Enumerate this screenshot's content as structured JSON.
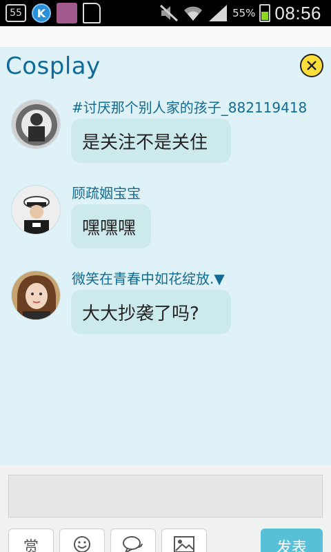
{
  "status_bar": {
    "badge_left": "55",
    "app_k": "K",
    "battery_percent": "55%",
    "battery_level": 0.55,
    "time": "08:56"
  },
  "header": {
    "title": "Cosplay"
  },
  "messages": [
    {
      "username": "#讨厌那个别人家的孩子_882119418",
      "text": "是关注不是关住"
    },
    {
      "username": "顾疏姻宝宝",
      "text": "嘿嘿嘿"
    },
    {
      "username": "微笑在青春中如花绽放.▼",
      "text": "大大抄袭了吗?"
    }
  ],
  "composer": {
    "input_value": "",
    "tools": [
      {
        "label": "赏",
        "icon": "reward-icon"
      },
      {
        "label": "",
        "icon": "emoji-icon"
      },
      {
        "label": "",
        "icon": "chat-bubble-icon"
      },
      {
        "label": "",
        "icon": "image-icon"
      }
    ],
    "send_label": "发表"
  },
  "colors": {
    "panel_bg": "#dff2f8",
    "bubble_bg": "#cce9ec",
    "accent_blue": "#0f6a9a",
    "send_bg": "#57bfd8",
    "close_yellow": "#ffde3a"
  }
}
